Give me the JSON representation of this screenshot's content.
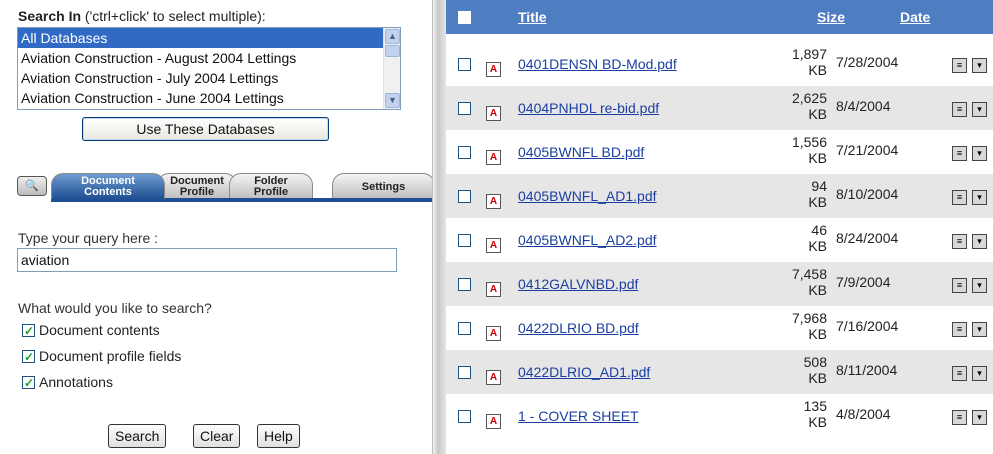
{
  "search_in": {
    "label_bold": "Search In",
    "label_hint": " ('ctrl+click' to select multiple):",
    "databases": [
      "All Databases",
      "Aviation Construction - August 2004 Lettings",
      "Aviation Construction - July 2004 Lettings",
      "Aviation Construction - June 2004 Lettings"
    ],
    "use_button": "Use These Databases"
  },
  "tabs": {
    "binoculars_icon": "binoculars-icon",
    "items": [
      {
        "line1": "Document",
        "line2": "Contents"
      },
      {
        "line1": "Document",
        "line2": "Profile"
      },
      {
        "line1": "Folder",
        "line2": "Profile"
      },
      {
        "line1": "Settings",
        "line2": ""
      }
    ],
    "active_color": "#1f4f93"
  },
  "query": {
    "label": "Type your query here :",
    "value": "aviation"
  },
  "search_options": {
    "label": "What would you like to search?",
    "options": [
      "Document contents",
      "Document profile fields",
      "Annotations"
    ]
  },
  "buttons": {
    "search": "Search",
    "clear": "Clear",
    "help": "Help"
  },
  "results": {
    "header_color": "#4f7dc1",
    "columns": {
      "title": "Title",
      "size": "Size",
      "date": "Date"
    },
    "rows": [
      {
        "title": "0401DENSN BD-Mod.pdf",
        "size": "1,897",
        "unit": "KB",
        "date": "7/28/2004"
      },
      {
        "title": "0404PNHDL re-bid.pdf",
        "size": "2,625",
        "unit": "KB",
        "date": "8/4/2004"
      },
      {
        "title": "0405BWNFL BD.pdf",
        "size": "1,556",
        "unit": "KB",
        "date": "7/21/2004"
      },
      {
        "title": "0405BWNFL_AD1.pdf",
        "size": "94",
        "unit": "KB",
        "date": "8/10/2004"
      },
      {
        "title": "0405BWNFL_AD2.pdf",
        "size": "46",
        "unit": "KB",
        "date": "8/24/2004"
      },
      {
        "title": "0412GALVNBD.pdf",
        "size": "7,458",
        "unit": "KB",
        "date": "7/9/2004"
      },
      {
        "title": "0422DLRIO BD.pdf",
        "size": "7,968",
        "unit": "KB",
        "date": "7/16/2004"
      },
      {
        "title": "0422DLRIO_AD1.pdf",
        "size": "508",
        "unit": "KB",
        "date": "8/11/2004"
      },
      {
        "title": "1 - COVER SHEET",
        "size": "135",
        "unit": "KB",
        "date": "4/8/2004"
      }
    ]
  }
}
